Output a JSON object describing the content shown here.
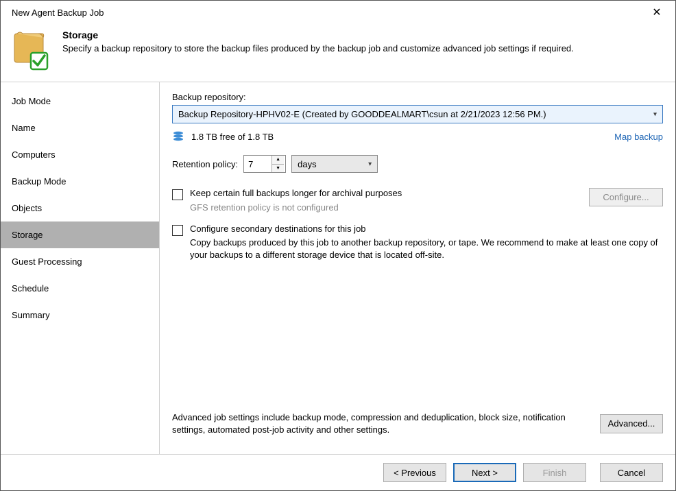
{
  "window": {
    "title": "New Agent Backup Job"
  },
  "header": {
    "title": "Storage",
    "description": "Specify a backup repository to store the backup files produced by the backup job and customize advanced job settings if required."
  },
  "sidebar": {
    "items": [
      {
        "label": "Job Mode"
      },
      {
        "label": "Name"
      },
      {
        "label": "Computers"
      },
      {
        "label": "Backup Mode"
      },
      {
        "label": "Objects"
      },
      {
        "label": "Storage"
      },
      {
        "label": "Guest Processing"
      },
      {
        "label": "Schedule"
      },
      {
        "label": "Summary"
      }
    ],
    "active_index": 5
  },
  "content": {
    "repo_label": "Backup repository:",
    "repo_selected": "Backup Repository-HPHV02-E (Created by GOODDEALMART\\csun at 2/21/2023 12:56 PM.)",
    "free_space": "1.8 TB free of 1.8 TB",
    "map_backup": "Map backup",
    "retention_label": "Retention policy:",
    "retention_value": "7",
    "retention_unit": "days",
    "gfs_checkbox_label": "Keep certain full backups longer for archival purposes",
    "gfs_sub": "GFS retention policy is not configured",
    "configure_btn": "Configure...",
    "secondary_checkbox_label": "Configure secondary destinations for this job",
    "secondary_desc": "Copy backups produced by this job to another backup repository, or tape. We recommend to make at least one copy of your backups to a different storage device that is located off-site.",
    "advanced_text": "Advanced job settings include backup mode, compression and deduplication, block size, notification settings, automated post-job activity and other settings.",
    "advanced_btn": "Advanced..."
  },
  "footer": {
    "previous": "< Previous",
    "next": "Next >",
    "finish": "Finish",
    "cancel": "Cancel"
  }
}
